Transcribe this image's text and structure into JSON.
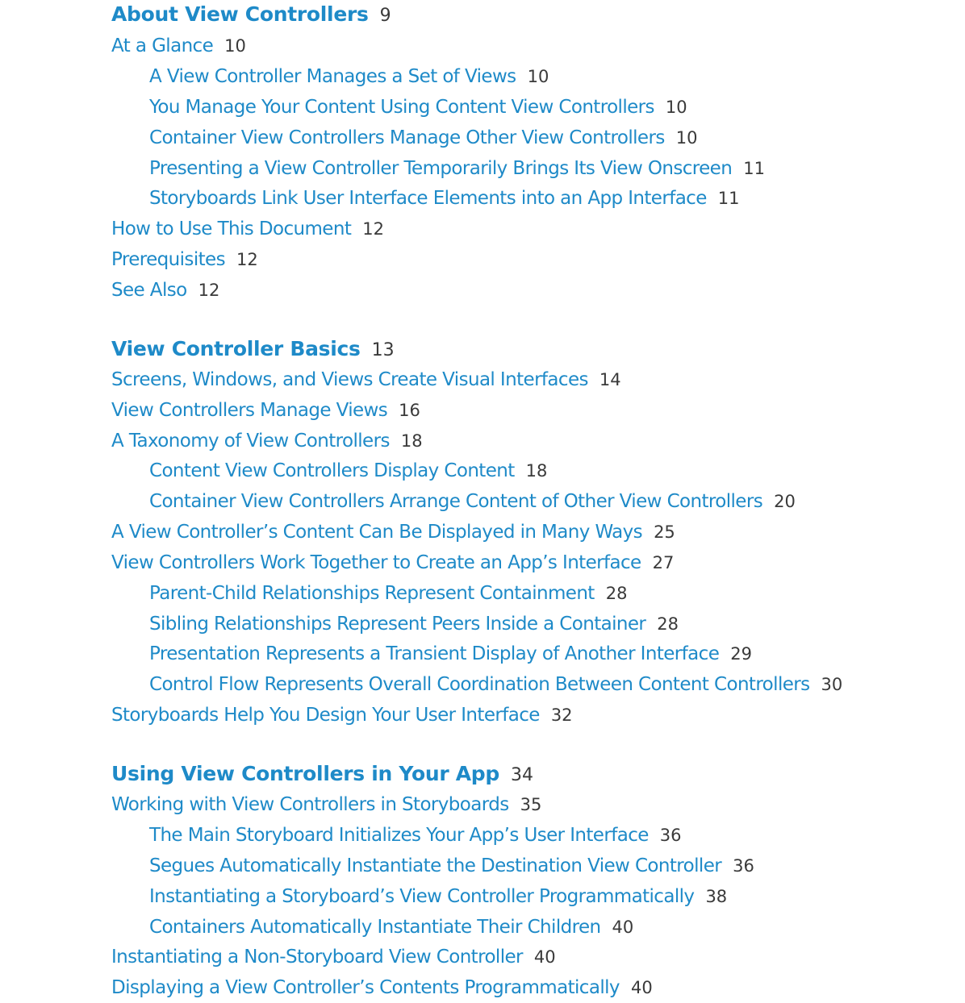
{
  "toc": [
    {
      "chapter": {
        "title": "About View Controllers",
        "page": "9"
      },
      "entries": [
        {
          "title": "At a Glance",
          "page": "10"
        },
        {
          "title": "A View Controller Manages a Set of Views",
          "page": "10"
        },
        {
          "title": "You Manage Your Content Using Content View Controllers",
          "page": "10"
        },
        {
          "title": "Container View Controllers Manage Other View Controllers",
          "page": "10"
        },
        {
          "title": "Presenting a View Controller Temporarily Brings Its View Onscreen",
          "page": "11"
        },
        {
          "title": "Storyboards Link User Interface Elements into an App Interface",
          "page": "11"
        },
        {
          "title": "How to Use This Document",
          "page": "12"
        },
        {
          "title": "Prerequisites",
          "page": "12"
        },
        {
          "title": "See Also",
          "page": "12"
        }
      ]
    },
    {
      "chapter": {
        "title": "View Controller Basics",
        "page": "13"
      },
      "entries": [
        {
          "title": "Screens, Windows, and Views Create Visual Interfaces",
          "page": "14"
        },
        {
          "title": "View Controllers Manage Views",
          "page": "16"
        },
        {
          "title": "A Taxonomy of View Controllers",
          "page": "18"
        },
        {
          "title": "Content View Controllers Display Content",
          "page": "18"
        },
        {
          "title": "Container View Controllers Arrange Content of Other View Controllers",
          "page": "20"
        },
        {
          "title": "A View Controller’s Content Can Be Displayed in Many Ways",
          "page": "25"
        },
        {
          "title": "View Controllers Work Together to Create an App’s Interface",
          "page": "27"
        },
        {
          "title": "Parent-Child Relationships Represent Containment",
          "page": "28"
        },
        {
          "title": "Sibling Relationships Represent Peers Inside a Container",
          "page": "28"
        },
        {
          "title": "Presentation Represents a Transient Display of Another Interface",
          "page": "29"
        },
        {
          "title": "Control Flow Represents Overall Coordination Between Content Controllers",
          "page": "30"
        },
        {
          "title": "Storyboards Help You Design Your User Interface",
          "page": "32"
        }
      ]
    },
    {
      "chapter": {
        "title": "Using View Controllers in Your App",
        "page": "34"
      },
      "entries": [
        {
          "title": "Working with View Controllers in Storyboards",
          "page": "35"
        },
        {
          "title": "The Main Storyboard Initializes Your App’s User Interface",
          "page": "36"
        },
        {
          "title": "Segues Automatically Instantiate the Destination View Controller",
          "page": "36"
        },
        {
          "title": "Instantiating a Storyboard’s View Controller Programmatically",
          "page": "38"
        },
        {
          "title": "Containers Automatically Instantiate Their Children",
          "page": "40"
        },
        {
          "title": "Instantiating a Non-Storyboard View Controller",
          "page": "40"
        },
        {
          "title": "Displaying a View Controller’s Contents Programmatically",
          "page": "40"
        }
      ]
    }
  ],
  "colors": {
    "link": "#1e8ac8",
    "page_number": "#3a3a3a",
    "background": "#ffffff"
  }
}
